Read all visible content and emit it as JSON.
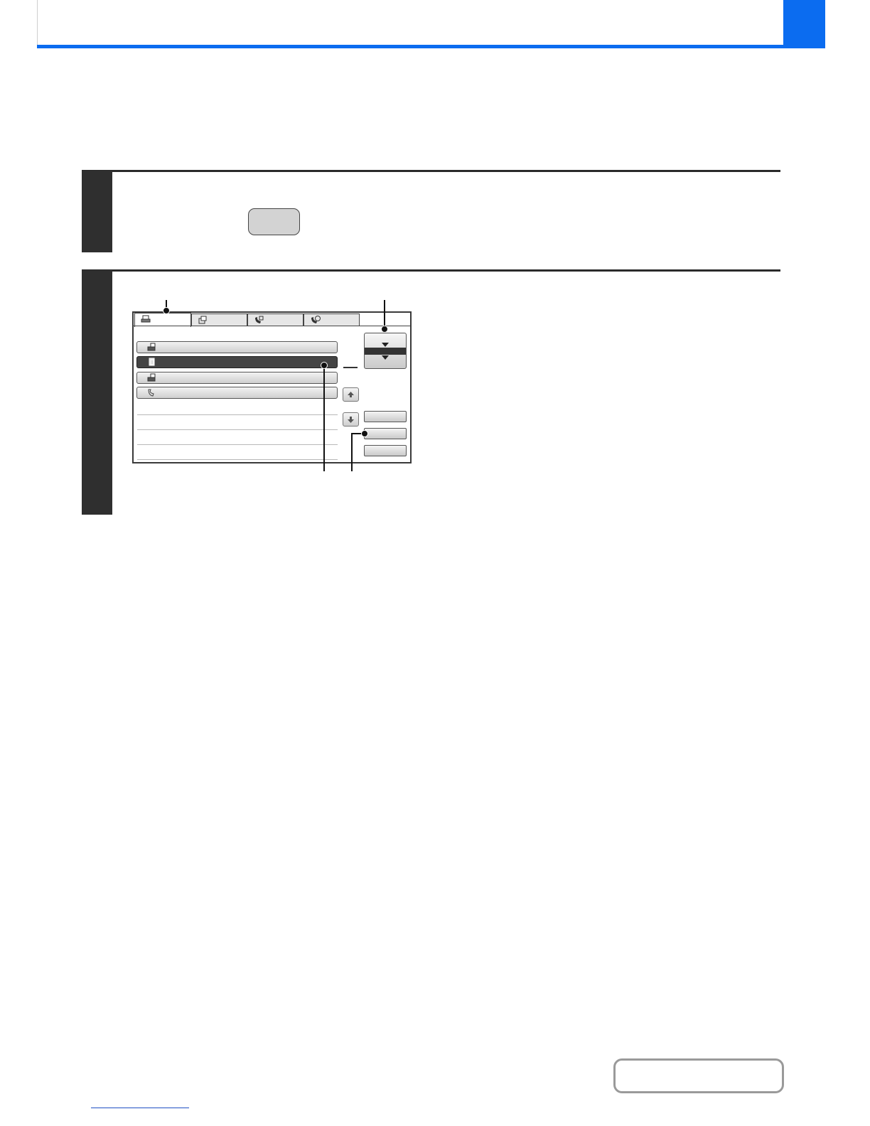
{
  "header": {
    "title": "",
    "chapter_tab": ""
  },
  "steps": [
    {
      "number": "",
      "text": ""
    },
    {
      "number": "",
      "text": ""
    }
  ],
  "key_button": {
    "label": ""
  },
  "job_panel": {
    "tabs": [
      {
        "icon": "print-icon",
        "label": "",
        "active": true
      },
      {
        "icon": "scan-icon",
        "label": "",
        "active": false
      },
      {
        "icon": "fax-icon",
        "label": "",
        "active": false
      },
      {
        "icon": "internet-fax-icon",
        "label": "",
        "active": false
      }
    ],
    "jobs": [
      {
        "icon": "print-job-icon",
        "label": "",
        "selected": false
      },
      {
        "icon": "copy-job-icon",
        "label": "",
        "selected": true
      },
      {
        "icon": "print-job-icon",
        "label": "",
        "selected": false
      },
      {
        "icon": "fax-job-icon",
        "label": "",
        "selected": false
      }
    ],
    "mode_button": {
      "label": ""
    },
    "side_buttons": [
      "",
      "",
      ""
    ],
    "colors": {
      "selected_row": "#444444",
      "accent": "#0b6cf0"
    }
  },
  "footer": {
    "contents_label": "",
    "link_text": ""
  }
}
